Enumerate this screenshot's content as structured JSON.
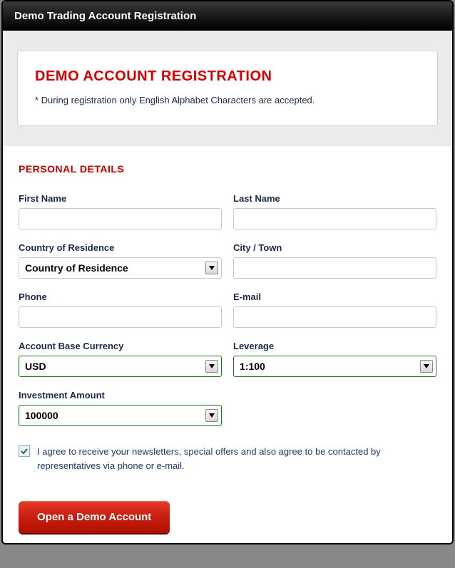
{
  "window": {
    "title": "Demo Trading Account Registration"
  },
  "intro": {
    "heading": "DEMO ACCOUNT REGISTRATION",
    "note": "* During registration only English Alphabet Characters are accepted."
  },
  "section_title": "PERSONAL DETAILS",
  "fields": {
    "first_name": {
      "label": "First Name",
      "value": ""
    },
    "last_name": {
      "label": "Last Name",
      "value": ""
    },
    "country": {
      "label": "Country of Residence",
      "selected": "Country of Residence"
    },
    "city": {
      "label": "City / Town",
      "value": ""
    },
    "phone": {
      "label": "Phone",
      "value": ""
    },
    "email": {
      "label": "E-mail",
      "value": ""
    },
    "currency": {
      "label": "Account Base Currency",
      "selected": "USD"
    },
    "leverage": {
      "label": "Leverage",
      "selected": "1:100"
    },
    "investment": {
      "label": "Investment Amount",
      "selected": "100000"
    }
  },
  "consent": {
    "checked": true,
    "text": "I agree to receive your newsletters, special offers and also agree to be contacted by representatives via phone or e-mail."
  },
  "submit_label": "Open a Demo Account"
}
